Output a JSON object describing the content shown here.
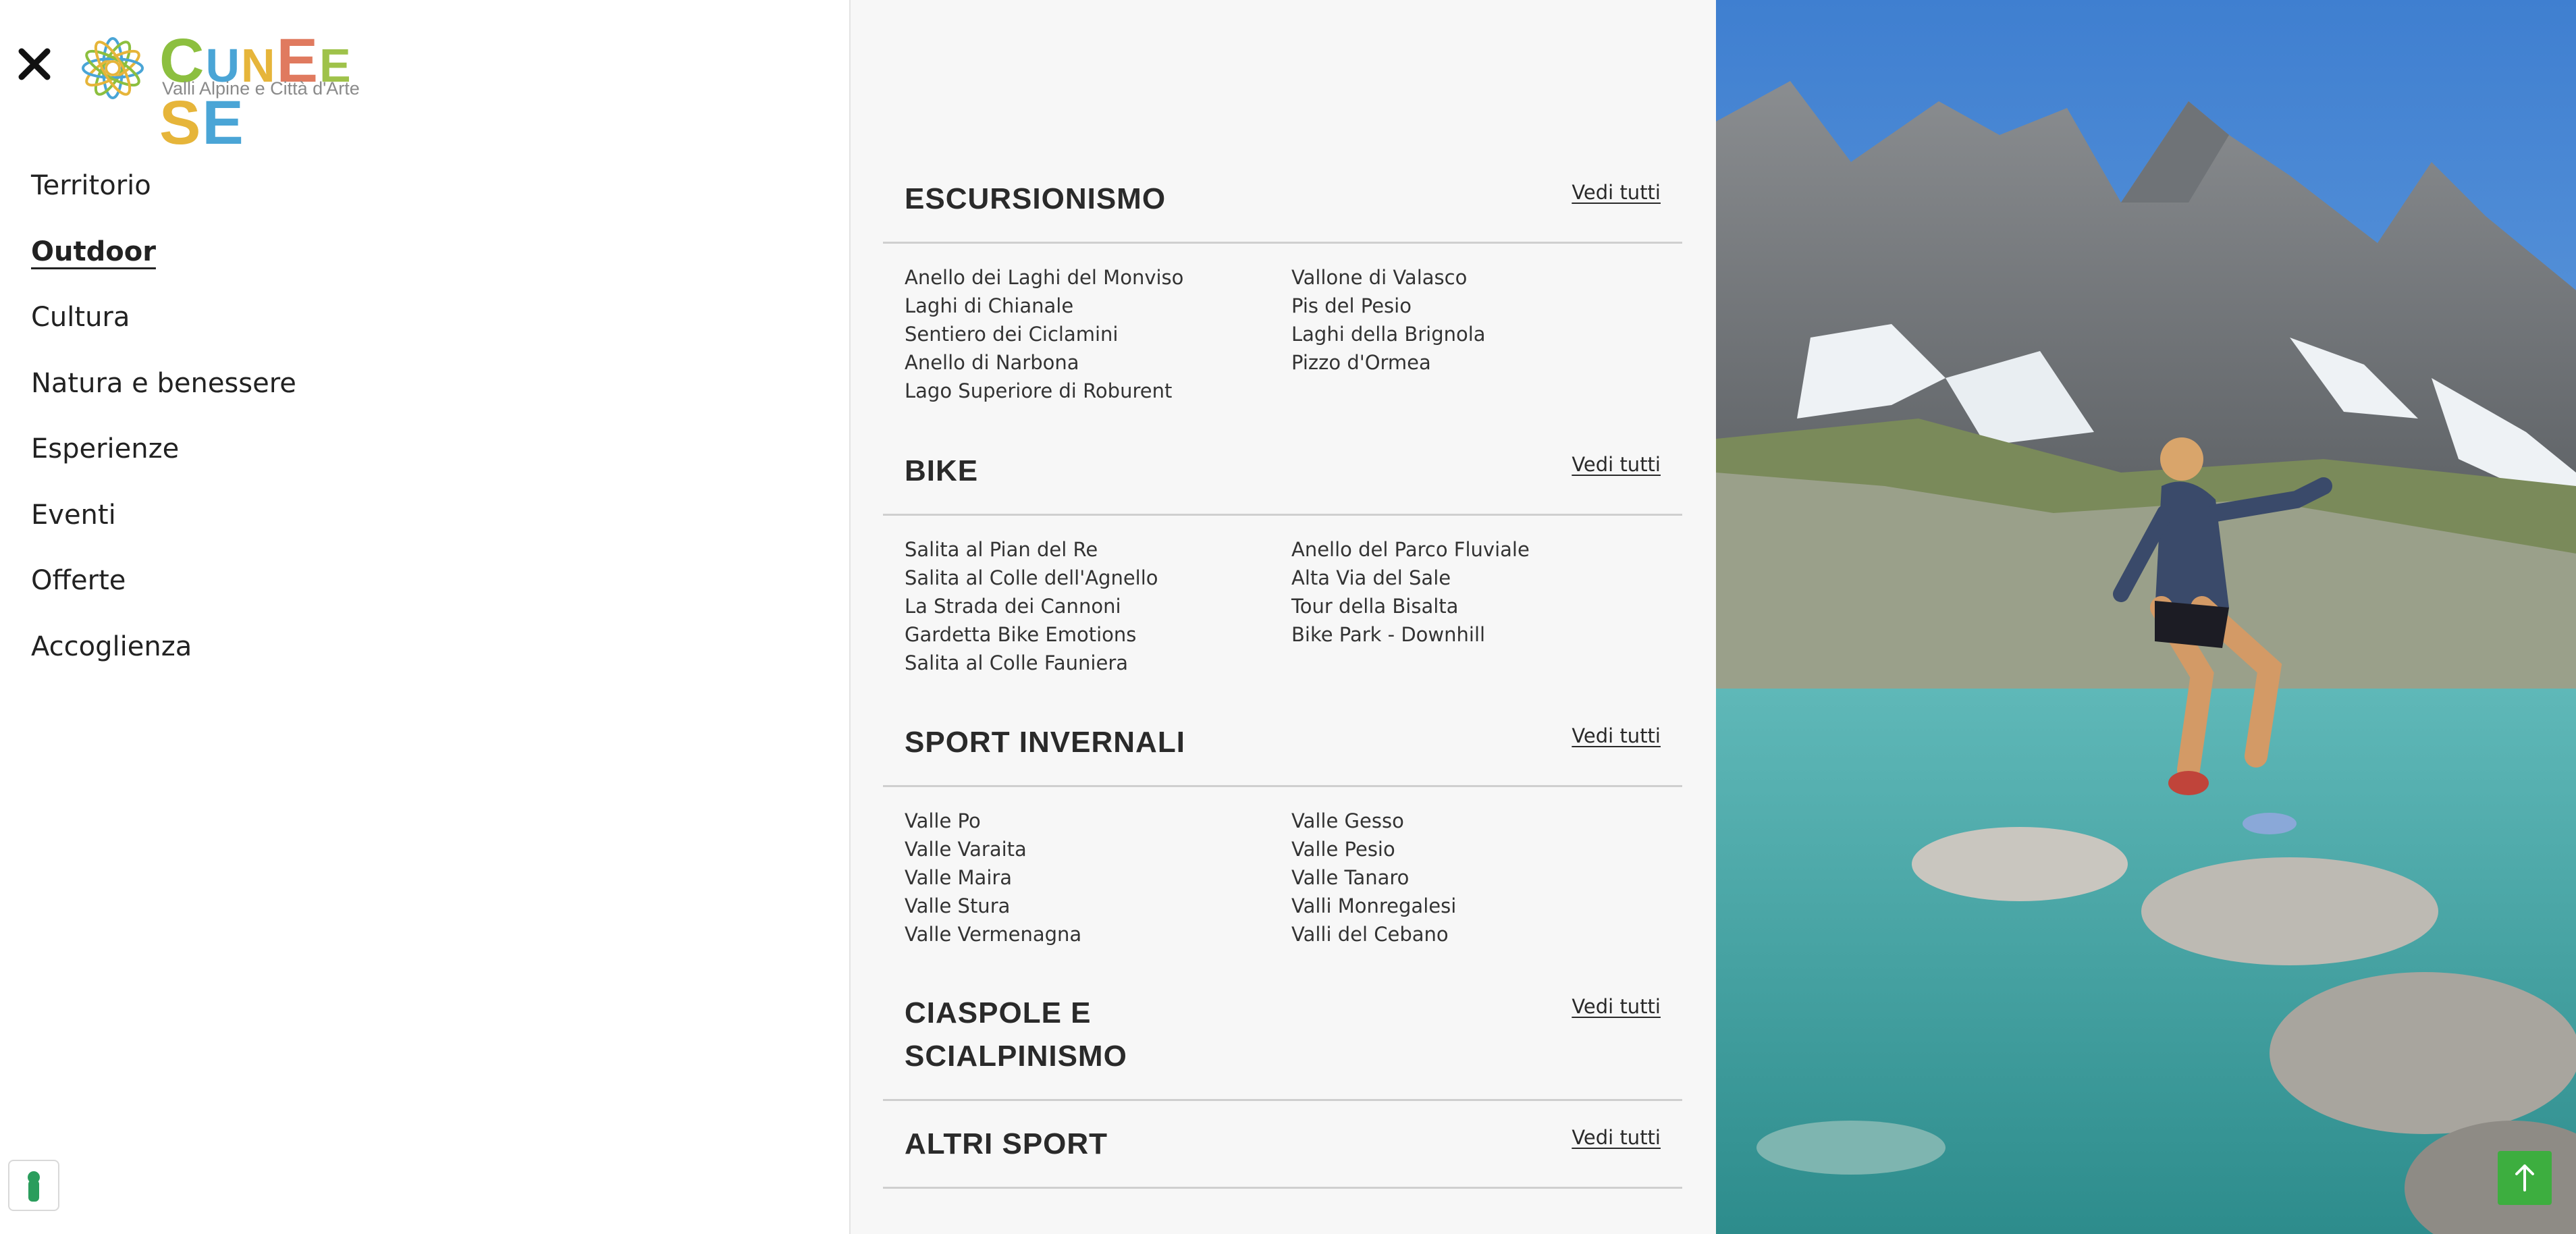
{
  "brand": {
    "logo_letters": [
      "C",
      "U",
      "N",
      "E",
      "E",
      "S",
      "E"
    ],
    "logo_colors": [
      "#8cbf3f",
      "#4aa5d6",
      "#e6b53a",
      "#e07a5f",
      "#9fc24a",
      "#e6b53a",
      "#4aa5d6"
    ],
    "tagline": "Valli Alpine e Città d'Arte"
  },
  "menu": {
    "close_icon": "close-icon",
    "items": [
      {
        "label": "Territorio",
        "active": false
      },
      {
        "label": "Outdoor",
        "active": true
      },
      {
        "label": "Cultura",
        "active": false
      },
      {
        "label": "Natura e benessere",
        "active": false
      },
      {
        "label": "Esperienze",
        "active": false
      },
      {
        "label": "Eventi",
        "active": false
      },
      {
        "label": "Offerte",
        "active": false
      },
      {
        "label": "Accoglienza",
        "active": false
      }
    ]
  },
  "submenu": {
    "sections": [
      {
        "title": "ESCURSIONISMO",
        "see_all": "Vedi tutti",
        "left": [
          "Anello dei Laghi del Monviso",
          "Laghi di Chianale",
          "Sentiero dei Ciclamini",
          "Anello di Narbona",
          "Lago Superiore di Roburent"
        ],
        "right": [
          "Vallone di Valasco",
          "Pis del Pesio",
          "Laghi della Brignola",
          "Pizzo d'Ormea"
        ]
      },
      {
        "title": "BIKE",
        "see_all": "Vedi tutti",
        "left": [
          "Salita al Pian del Re",
          "Salita al Colle dell'Agnello",
          "La Strada dei Cannoni",
          "Gardetta Bike Emotions",
          "Salita al Colle Fauniera"
        ],
        "right": [
          "Anello del Parco Fluviale",
          "Alta Via del Sale",
          "Tour della Bisalta",
          "Bike Park - Downhill"
        ]
      },
      {
        "title": "SPORT INVERNALI",
        "see_all": "Vedi tutti",
        "left": [
          "Valle Po",
          "Valle Varaita",
          "Valle Maira",
          "Valle Stura",
          "Valle Vermenagna"
        ],
        "right": [
          "Valle Gesso",
          "Valle Pesio",
          "Valle Tanaro",
          "Valli Monregalesi",
          "Valli del Cebano"
        ]
      },
      {
        "title_line1": "CIASPOLE E",
        "title_line2": "SCIALPINISMO",
        "see_all": "Vedi tutti"
      },
      {
        "title": "ALTRI SPORT",
        "see_all": "Vedi tutti"
      }
    ]
  },
  "colors": {
    "accent_green": "#3dae3f",
    "panel_bg": "#f7f7f7"
  },
  "icons": {
    "cookie": "cookie-settings-icon",
    "scroll_top": "arrow-up-icon"
  }
}
